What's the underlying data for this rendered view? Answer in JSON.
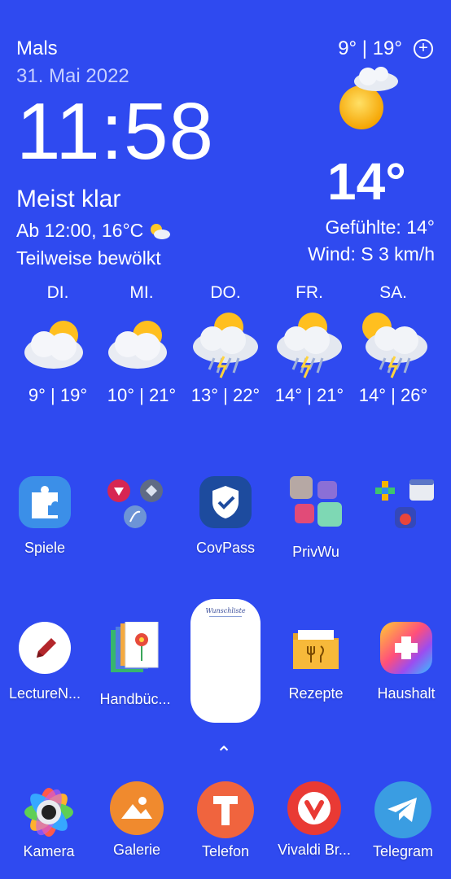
{
  "weather": {
    "location": "Mals",
    "date": "31. Mai 2022",
    "time": "11:58",
    "condition": "Meist klar",
    "hourly": "Ab 12:00, 16°C",
    "hourly_desc": "Teilweise bewölkt",
    "minmax": "9° | 19°",
    "add_icon": "+",
    "temp": "14°",
    "feels_like": "Gefühlte: 14°",
    "wind": "Wind: S 3 km/h"
  },
  "forecast": [
    {
      "day": "DI.",
      "temps": "9° | 19°",
      "icon": "partly-cloudy-icon"
    },
    {
      "day": "MI.",
      "temps": "10° | 21°",
      "icon": "partly-cloudy-icon"
    },
    {
      "day": "DO.",
      "temps": "13° | 22°",
      "icon": "thunderstorm-icon"
    },
    {
      "day": "FR.",
      "temps": "14° | 21°",
      "icon": "thunderstorm-icon"
    },
    {
      "day": "SA.",
      "temps": "14° | 26°",
      "icon": "thunderstorm-icon"
    }
  ],
  "apps_row1": [
    {
      "label": "Spiele",
      "icon": "puzzle-icon"
    },
    {
      "label": "",
      "icon": "folder-icon"
    },
    {
      "label": "CovPass",
      "icon": "shield-check-icon"
    },
    {
      "label": "PrivWu",
      "icon": "folder-icon"
    },
    {
      "label": "",
      "icon": "folder-icon"
    }
  ],
  "apps_row2": [
    {
      "label": "LectureN...",
      "icon": "pencil-icon"
    },
    {
      "label": "Handbüc...",
      "icon": "book-icon"
    },
    {
      "label": "Rezepte",
      "icon": "folder-icon"
    },
    {
      "label": "Haushalt",
      "icon": "game-controller-icon"
    }
  ],
  "widget": {
    "title": "Wunschliste"
  },
  "drawer": {
    "chevron": "⌃"
  },
  "dock": [
    {
      "label": "Kamera",
      "icon": "camera-icon"
    },
    {
      "label": "Galerie",
      "icon": "gallery-icon"
    },
    {
      "label": "Telefon",
      "icon": "phone-icon"
    },
    {
      "label": "Vivaldi Br...",
      "icon": "vivaldi-icon"
    },
    {
      "label": "Telegram",
      "icon": "telegram-icon"
    }
  ],
  "colors": {
    "background": "#2f4af0"
  }
}
